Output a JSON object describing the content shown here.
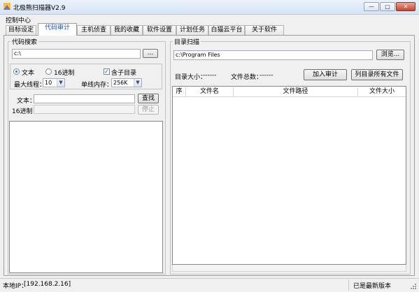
{
  "window": {
    "title": "北极熊扫描器V2.9",
    "minimize_glyph": "—",
    "maximize_glyph": "□",
    "close_glyph": "✕",
    "icon": "app-icon"
  },
  "menu": {
    "control_center": "控制中心"
  },
  "tabs": [
    "目标设定",
    "代码审计",
    "主机侦查",
    "我的收藏",
    "软件设置",
    "计划任务",
    "白猫云平台",
    "关于软件"
  ],
  "active_tab": "代码审计",
  "code_search": {
    "group_title": "代码搜索",
    "path_value": "c:\\",
    "browse_label": "...",
    "mode_text_label": "文本",
    "mode_hex_label": "16进制",
    "include_subdirs_label": "含子目录",
    "max_threads_label": "最大线程：",
    "max_threads_value": "10",
    "memory_label": "单线内存：",
    "memory_value": "256K",
    "text_label": "文本：",
    "text_value": "",
    "hex_label": "16进制：",
    "hex_value": "",
    "find_label": "查找",
    "stop_label": "停止"
  },
  "dir_scan": {
    "group_title": "目录扫描",
    "path_value": "c:\\Program Files",
    "browse_label": "浏览...",
    "dir_size_label": "目录大小：",
    "dir_size_value": "------",
    "file_count_label": "文件总数：",
    "file_count_value": "------",
    "add_audit_label": "加入审计",
    "list_all_label": "列目录所有文件",
    "columns": [
      "序",
      "文件名",
      "文件路径",
      "文件大小"
    ]
  },
  "status": {
    "local_ip_label": "本地IP：",
    "local_ip_value": "[192.168.2.16]",
    "version_status": "已是最新版本"
  }
}
